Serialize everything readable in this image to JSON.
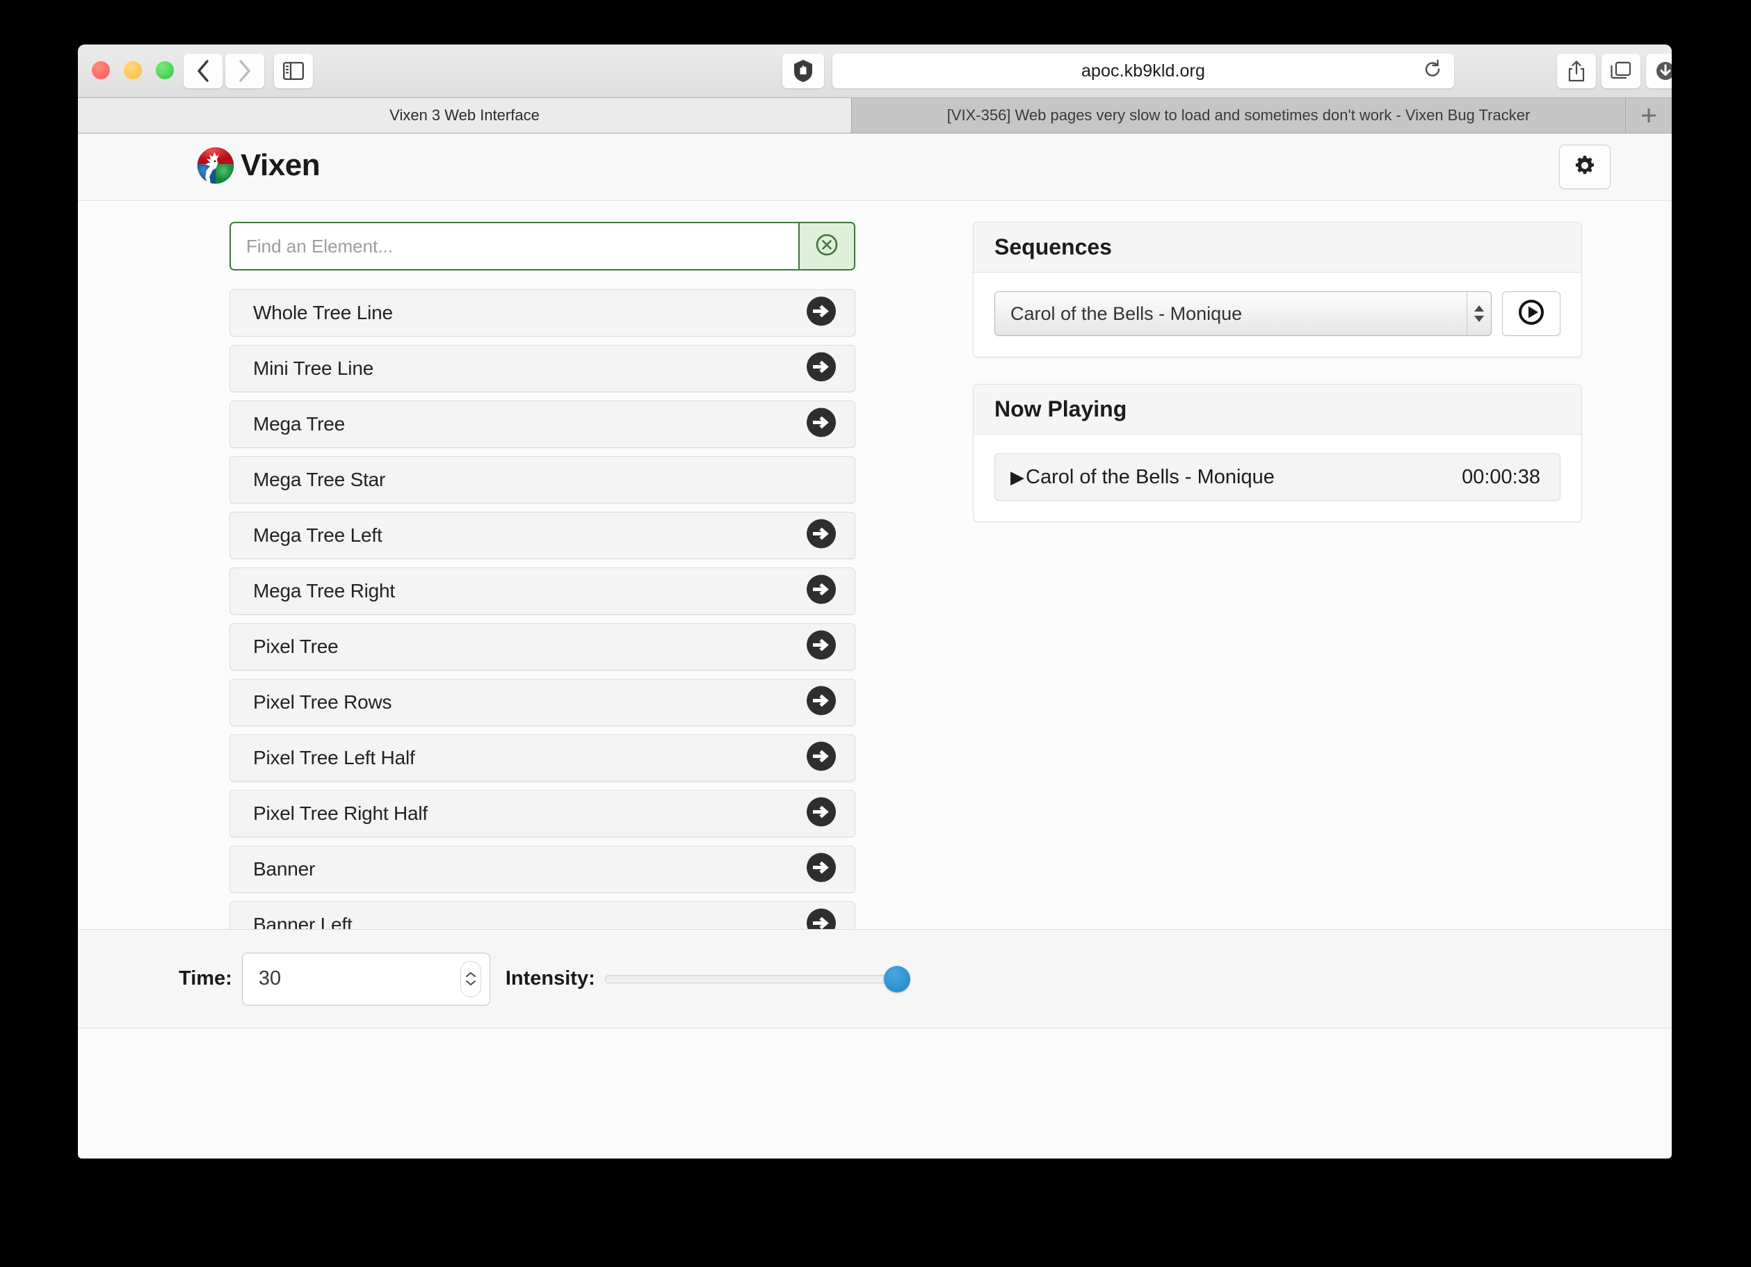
{
  "browser": {
    "url": "apoc.kb9kld.org",
    "traffic_lights": [
      "close",
      "minimize",
      "maximize"
    ],
    "nav": {
      "back": "back-icon",
      "forward": "forward-icon",
      "sidebar": "sidebar-icon"
    },
    "shield_icon": "shield-blocker-icon",
    "reload_icon": "reload-icon",
    "right_buttons": [
      "share-icon",
      "tab-overview-icon",
      "downloads-icon"
    ],
    "tabs": [
      {
        "title": "Vixen 3 Web Interface",
        "active": true
      },
      {
        "title": "[VIX-356] Web pages very slow to load and sometimes don't work - Vixen Bug Tracker",
        "active": false
      }
    ],
    "new_tab_label": "+"
  },
  "app": {
    "brand_name": "Vixen",
    "logo_icon": "vixen-reindeer-logo",
    "settings_icon": "gear-icon"
  },
  "search": {
    "placeholder": "Find an Element...",
    "value": "",
    "clear_icon": "clear-circle-x-icon",
    "border_color": "#3c763d",
    "clear_bg_color": "#dff0d8"
  },
  "elements": {
    "items": [
      {
        "label": "Whole Tree Line",
        "has_arrow": true
      },
      {
        "label": "Mini Tree Line",
        "has_arrow": true
      },
      {
        "label": "Mega Tree",
        "has_arrow": true
      },
      {
        "label": "Mega Tree Star",
        "has_arrow": false
      },
      {
        "label": "Mega Tree Left",
        "has_arrow": true
      },
      {
        "label": "Mega Tree Right",
        "has_arrow": true
      },
      {
        "label": "Pixel Tree",
        "has_arrow": true
      },
      {
        "label": "Pixel Tree Rows",
        "has_arrow": true
      },
      {
        "label": "Pixel Tree Left Half",
        "has_arrow": true
      },
      {
        "label": "Pixel Tree Right Half",
        "has_arrow": true
      },
      {
        "label": "Banner",
        "has_arrow": true
      },
      {
        "label": "Banner Left",
        "has_arrow": true
      }
    ]
  },
  "sequences": {
    "title": "Sequences",
    "selected": "Carol of the Bells - Monique",
    "options": [
      "Carol of the Bells - Monique"
    ],
    "play_icon": "play-circle-icon",
    "stepper_icon": "updown-arrows-icon"
  },
  "now_playing": {
    "title": "Now Playing",
    "caret_icon": "play-triangle-icon",
    "track": "Carol of the Bells - Monique",
    "time": "00:00:38"
  },
  "controls": {
    "time_label": "Time:",
    "time_value": "30",
    "intensity_label": "Intensity:",
    "intensity_percent": 100,
    "thumb_color": "#1b84c6"
  }
}
